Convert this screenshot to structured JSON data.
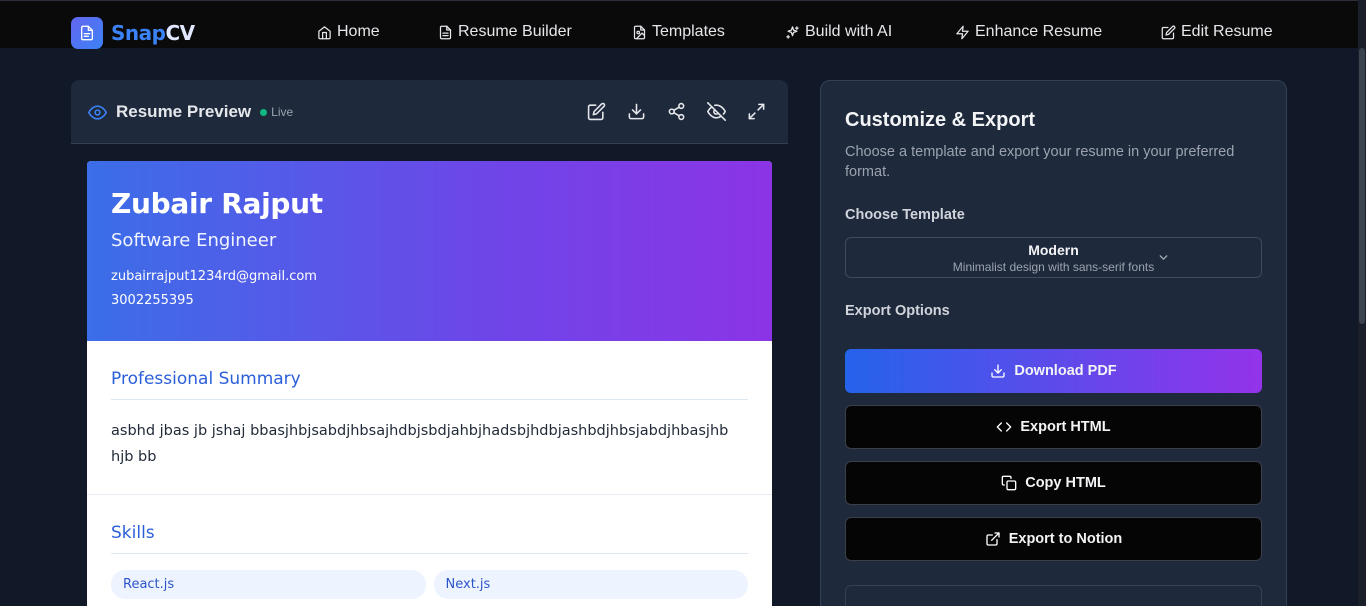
{
  "app": {
    "logo_part1": "Snap",
    "logo_part2": "CV",
    "logo_icon": "document-icon"
  },
  "nav": {
    "items": [
      {
        "label": "Home",
        "icon": "home-icon"
      },
      {
        "label": "Resume Builder",
        "icon": "file-text-icon"
      },
      {
        "label": "Templates",
        "icon": "file-image-icon"
      },
      {
        "label": "Build with AI",
        "icon": "sparkles-icon"
      },
      {
        "label": "Enhance Resume",
        "icon": "zap-icon"
      },
      {
        "label": "Edit Resume",
        "icon": "edit-icon"
      }
    ]
  },
  "preview": {
    "title": "Resume Preview",
    "status": "Live",
    "tools": [
      "edit-icon",
      "download-icon",
      "share-icon",
      "eye-off-icon",
      "expand-icon"
    ]
  },
  "resume": {
    "name": "Zubair Rajput",
    "role": "Software Engineer",
    "email": "zubairrajput1234rd@gmail.com",
    "phone": "3002255395",
    "summary_title": "Professional Summary",
    "summary": "asbhd jbas jb jshaj bbasjhbjsabdjhbsajhdbjsbdjahbjhadsbjhdbjashbdjhbsjabdjhbasjhb hjb bb",
    "skills_title": "Skills",
    "skills": [
      "React.js",
      "Next.js"
    ]
  },
  "panel": {
    "title": "Customize & Export",
    "description": "Choose a template and export your resume in your preferred format.",
    "choose_template_label": "Choose Template",
    "template_name": "Modern",
    "template_desc": "Minimalist design with sans-serif fonts",
    "export_options_label": "Export Options",
    "buttons": {
      "download_pdf": "Download PDF",
      "export_html": "Export HTML",
      "copy_html": "Copy HTML",
      "export_notion": "Export to Notion"
    }
  },
  "colors": {
    "background": "#111827",
    "accent_blue": "#2563eb",
    "accent_purple": "#9333ea",
    "live_green": "#10b981"
  }
}
